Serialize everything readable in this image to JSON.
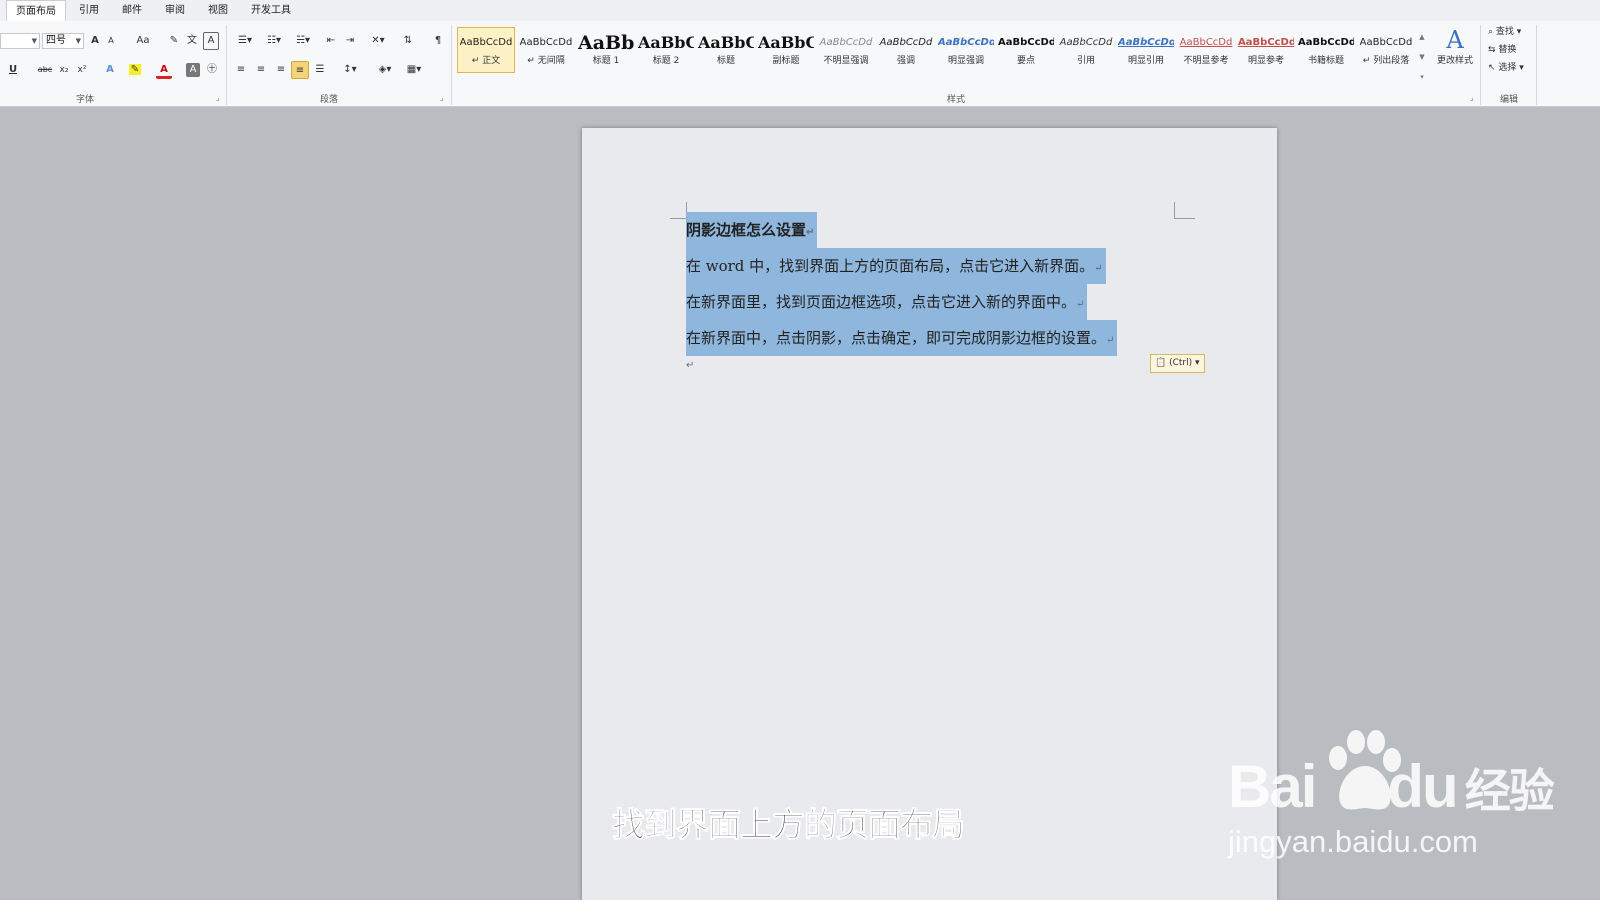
{
  "tabs": [
    "页面布局",
    "引用",
    "邮件",
    "审阅",
    "视图",
    "开发工具"
  ],
  "ribbon": {
    "font_group_label": "字体",
    "paragraph_group_label": "段落",
    "styles_group_label": "样式",
    "editing_group_label": "编辑",
    "font_size": "四号",
    "change_case_label": "Aa",
    "grow_font_label": "A",
    "shrink_font_label": "A",
    "underline_label": "U",
    "strike_label": "abc",
    "subscript_label": "x₂",
    "superscript_label": "x²",
    "change_styles_label": "更改样式",
    "find_label": "查找",
    "replace_label": "替换",
    "select_label": "选择"
  },
  "styles": [
    {
      "sample": "AaBbCcDd",
      "name": "↵ 正文"
    },
    {
      "sample": "AaBbCcDd",
      "name": "↵ 无间隔"
    },
    {
      "sample": "AaBb",
      "name": "标题 1"
    },
    {
      "sample": "AaBbC",
      "name": "标题 2"
    },
    {
      "sample": "AaBbC",
      "name": "标题"
    },
    {
      "sample": "AaBbC",
      "name": "副标题"
    },
    {
      "sample": "AaBbCcDd",
      "name": "不明显强调"
    },
    {
      "sample": "AaBbCcDd",
      "name": "强调"
    },
    {
      "sample": "AaBbCcDd",
      "name": "明显强调"
    },
    {
      "sample": "AaBbCcDd",
      "name": "要点"
    },
    {
      "sample": "AaBbCcDd",
      "name": "引用"
    },
    {
      "sample": "AaBbCcDd",
      "name": "明显引用"
    },
    {
      "sample": "AaBbCcDd",
      "name": "不明显参考"
    },
    {
      "sample": "AaBbCcDd",
      "name": "明显参考"
    },
    {
      "sample": "AaBbCcDd",
      "name": "书籍标题"
    },
    {
      "sample": "AaBbCcDd",
      "name": "↵ 列出段落"
    }
  ],
  "document": {
    "lines": [
      "阴影边框怎么设置",
      "在 word 中，找到界面上方的页面布局，点击它进入新界面。",
      "在新界面里，找到页面边框选项，点击它进入新的界面中。",
      "在新界面中，点击阴影，点击确定，即可完成阴影边框的设置。"
    ],
    "paragraph_mark": "↵",
    "paste_options": "(Ctrl)"
  },
  "caption": "找到界面上方的页面布局",
  "watermark": {
    "brand": "Bai",
    "brand_suffix": "du",
    "brand_cn": "经验",
    "url": "jingyan.baidu.com"
  }
}
